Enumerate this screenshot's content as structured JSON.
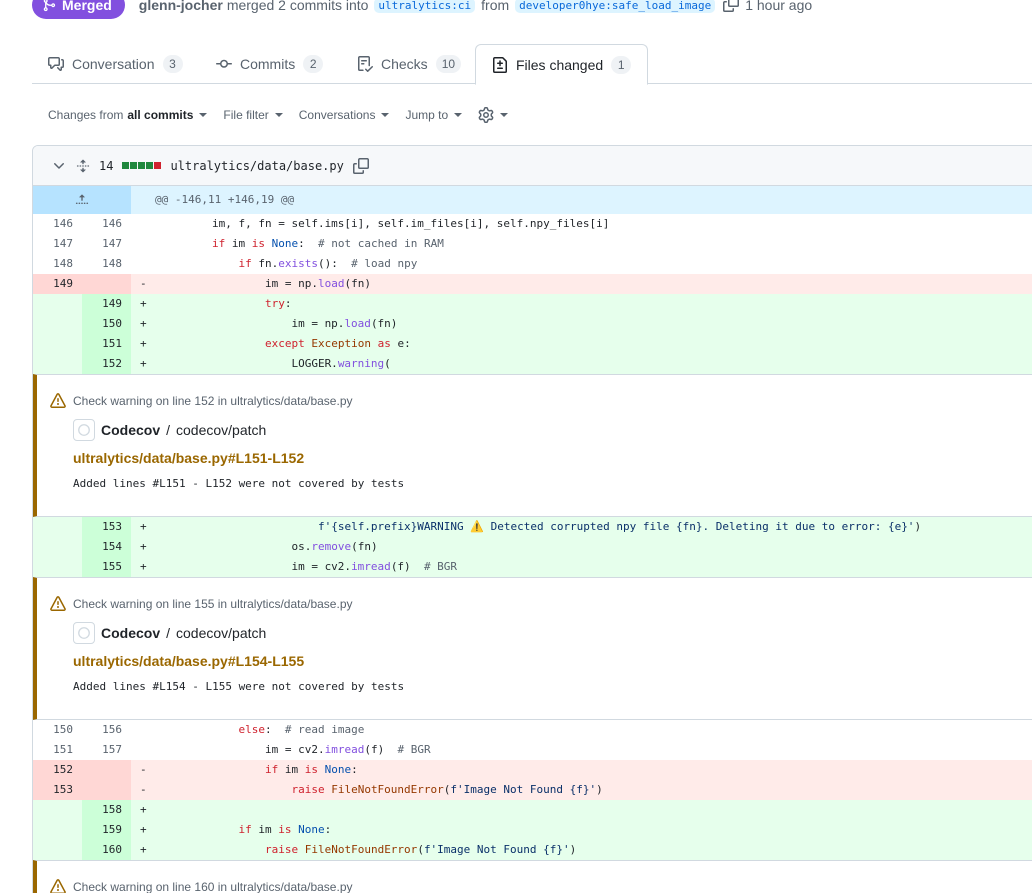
{
  "header": {
    "state": "Merged",
    "author": "glenn-jocher",
    "action": "merged 2 commits into",
    "base_branch": "ultralytics:ci",
    "from_word": "from",
    "head_branch": "developer0hye:safe_load_image",
    "time": "1 hour ago"
  },
  "tabs": [
    {
      "label": "Conversation",
      "count": "3",
      "icon": "comment-discussion-icon"
    },
    {
      "label": "Commits",
      "count": "2",
      "icon": "git-commit-icon"
    },
    {
      "label": "Checks",
      "count": "10",
      "icon": "checklist-icon"
    },
    {
      "label": "Files changed",
      "count": "1",
      "icon": "file-diff-icon"
    }
  ],
  "toolbar": {
    "changes_prefix": "Changes from",
    "changes_value": "all commits",
    "file_filter": "File filter",
    "conversations": "Conversations",
    "jump_to": "Jump to"
  },
  "file": {
    "changes": "14",
    "path": "ultralytics/data/base.py",
    "hunk": "@@ -146,11 +146,19 @@"
  },
  "lines": [
    {
      "old": "146",
      "new": "146",
      "sign": "",
      "type": "ctx",
      "text": "        im, f, fn = self.ims[i], self.im_files[i], self.npy_files[i]"
    },
    {
      "old": "147",
      "new": "147",
      "sign": "",
      "type": "ctx",
      "text": "        if im is None:  # not cached in RAM"
    },
    {
      "old": "148",
      "new": "148",
      "sign": "",
      "type": "ctx",
      "text": "            if fn.exists():  # load npy"
    },
    {
      "old": "149",
      "new": "",
      "sign": "-",
      "type": "del",
      "text": "                im = np.load(fn)"
    },
    {
      "old": "",
      "new": "149",
      "sign": "+",
      "type": "add",
      "text": "                try:"
    },
    {
      "old": "",
      "new": "150",
      "sign": "+",
      "type": "add",
      "text": "                    im = np.load(fn)"
    },
    {
      "old": "",
      "new": "151",
      "sign": "+",
      "type": "add",
      "text": "                except Exception as e:"
    },
    {
      "old": "",
      "new": "152",
      "sign": "+",
      "type": "add",
      "text": "                    LOGGER.warning("
    },
    {
      "old": "",
      "new": "153",
      "sign": "+",
      "type": "add",
      "text": "                        f'{self.prefix}WARNING ⚠️ Detected corrupted npy file {fn}. Deleting it due to error: {e}')"
    },
    {
      "old": "",
      "new": "154",
      "sign": "+",
      "type": "add",
      "text": "                    os.remove(fn)"
    },
    {
      "old": "",
      "new": "155",
      "sign": "+",
      "type": "add",
      "text": "                    im = cv2.imread(f)  # BGR"
    },
    {
      "old": "150",
      "new": "156",
      "sign": "",
      "type": "ctx",
      "text": "            else:  # read image"
    },
    {
      "old": "151",
      "new": "157",
      "sign": "",
      "type": "ctx",
      "text": "                im = cv2.imread(f)  # BGR"
    },
    {
      "old": "152",
      "new": "",
      "sign": "-",
      "type": "del",
      "text": "                if im is None:"
    },
    {
      "old": "153",
      "new": "",
      "sign": "-",
      "type": "del",
      "text": "                    raise FileNotFoundError(f'Image Not Found {f}')"
    },
    {
      "old": "",
      "new": "158",
      "sign": "+",
      "type": "add",
      "text": ""
    },
    {
      "old": "",
      "new": "159",
      "sign": "+",
      "type": "add",
      "text": "            if im is None:"
    },
    {
      "old": "",
      "new": "160",
      "sign": "+",
      "type": "add",
      "text": "                raise FileNotFoundError(f'Image Not Found {f}')"
    }
  ],
  "annotations": [
    {
      "title": "Check warning on line 152 in ultralytics/data/base.py",
      "app": "Codecov",
      "check": "codecov/patch",
      "link": "ultralytics/data/base.py#L151-L152",
      "message": "Added lines #L151 - L152 were not covered by tests"
    },
    {
      "title": "Check warning on line 155 in ultralytics/data/base.py",
      "app": "Codecov",
      "check": "codecov/patch",
      "link": "ultralytics/data/base.py#L154-L155",
      "message": "Added lines #L154 - L155 were not covered by tests"
    },
    {
      "title": "Check warning on line 160 in ultralytics/data/base.py"
    }
  ],
  "colors": {
    "merged": "#8250df",
    "add_bg": "#e6ffec",
    "del_bg": "#ffebe9",
    "warning": "#9a6700"
  }
}
